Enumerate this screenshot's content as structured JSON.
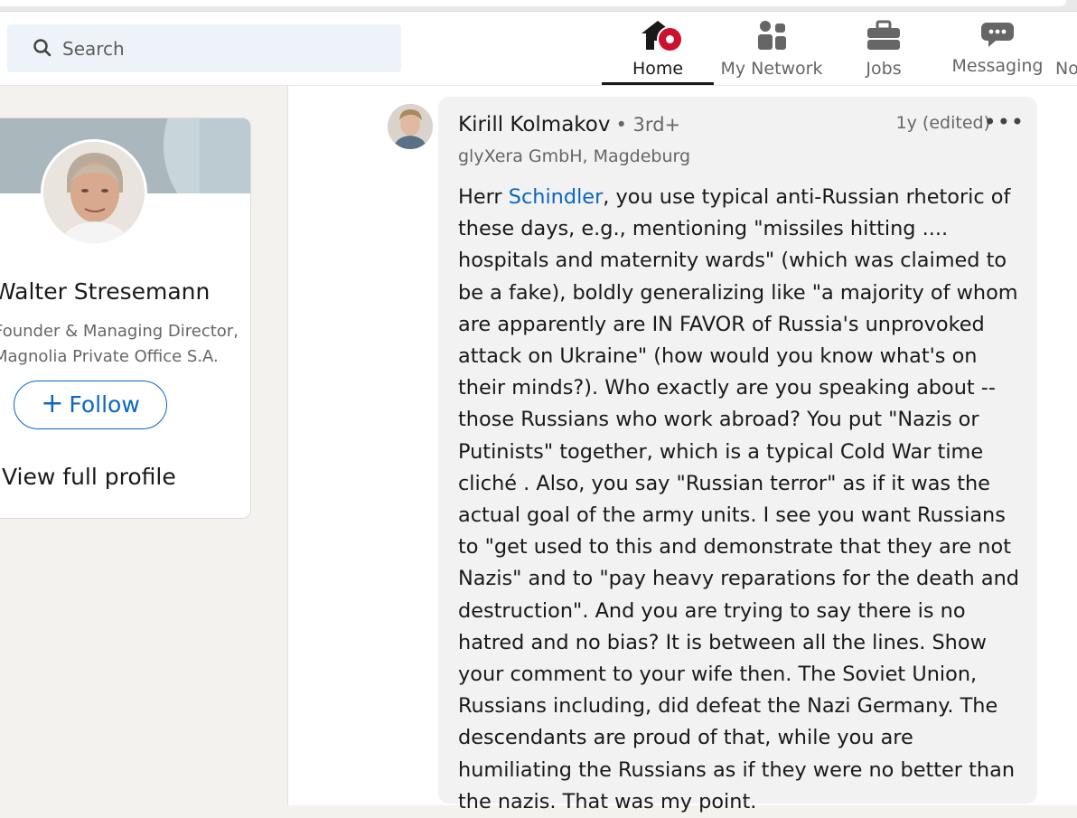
{
  "search": {
    "placeholder": "Search"
  },
  "nav": {
    "home": "Home",
    "network": "My Network",
    "jobs": "Jobs",
    "messaging": "Messaging",
    "notifications_partial": "No"
  },
  "profile_card": {
    "name": "Walter Stresemann",
    "title_line1": "Founder & Managing Director,",
    "title_line2": "Magnolia Private Office S.A.",
    "follow_label": "Follow",
    "view_profile": "View full profile"
  },
  "comment": {
    "author": "Kirill Kolmakov",
    "degree": "• 3rd+",
    "timestamp": "1y (edited)",
    "subtitle": "glyXera GmbH, Magdeburg",
    "text_prefix": "Herr ",
    "mention": "Schindler",
    "text_body": ", you use typical anti-Russian rhetoric of these days, e.g., mentioning \"missiles hitting .... hospitals and maternity wards\" (which was claimed to be a fake), boldly generalizing like \"a majority of whom are apparently are IN FAVOR of Russia's unprovoked attack on Ukraine\" (how would you know what's on their minds?). Who exactly are you speaking about -- those Russians who work abroad? You put \"Nazis or Putinists\" together, which is a typical Cold War time cliché . Also, you say \"Russian terror\" as if it was the actual goal of the army units. I see you want Russians to \"get used to this and demonstrate that they are not Nazis\" and to \"pay heavy reparations for the death and destruction\". And you are trying to say there is no hatred and no bias? It is between all the lines. Show your comment to your wife then. The Soviet Union, Russians including, did defeat the Nazi Germany. The descendants are proud of that, while you are humiliating the Russians as if they were no better than the nazis. That was my point."
  },
  "icons": {
    "search": "search-icon",
    "home": "home-icon",
    "network": "people-icon",
    "jobs": "briefcase-icon",
    "messaging": "chat-icon",
    "more": "ellipsis-icon"
  },
  "colors": {
    "brand": "#0a66c2",
    "badge": "#cb112d"
  }
}
